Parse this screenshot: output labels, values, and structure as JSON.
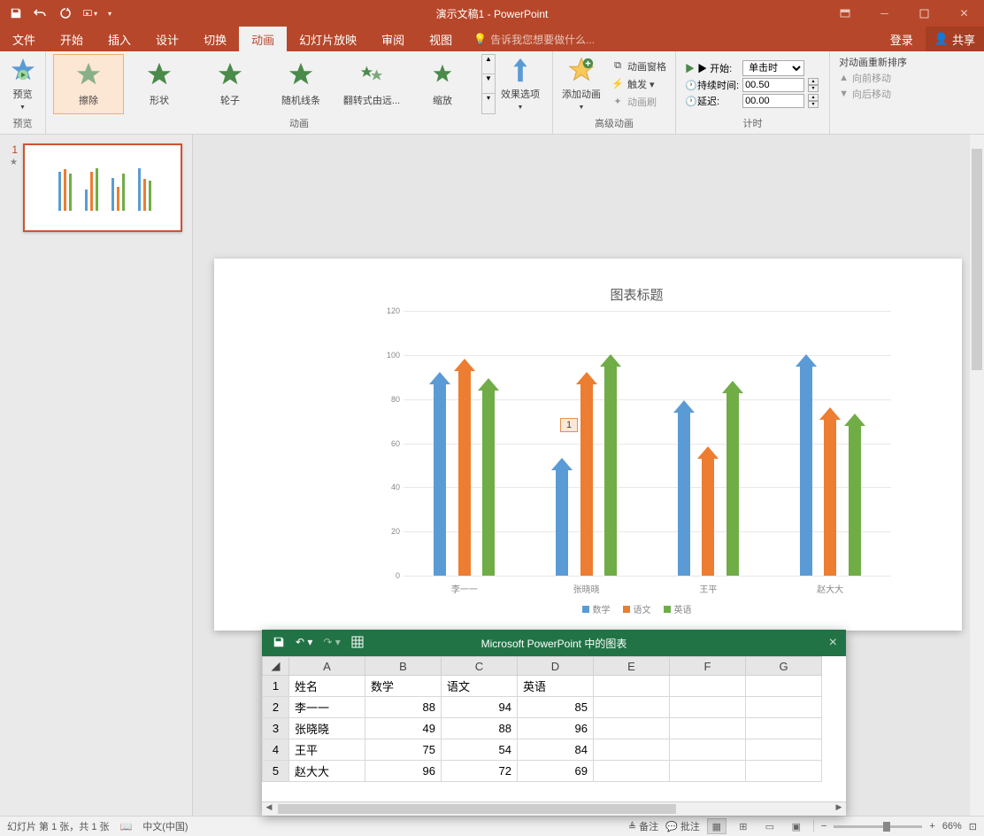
{
  "titlebar": {
    "title": "演示文稿1 - PowerPoint"
  },
  "tabs": {
    "file": "文件",
    "home": "开始",
    "insert": "插入",
    "design": "设计",
    "transitions": "切换",
    "animations": "动画",
    "slideshow": "幻灯片放映",
    "review": "审阅",
    "view": "视图",
    "tellme": "告诉我您想要做什么...",
    "login": "登录",
    "share": "共享"
  },
  "ribbon": {
    "preview": "预览",
    "preview_group": "预览",
    "anim_group": "动画",
    "gallery": {
      "wipe": "擦除",
      "shape": "形状",
      "wheel": "轮子",
      "random_bars": "随机线条",
      "flip": "翻转式由远...",
      "zoom": "缩放"
    },
    "effect_options": "效果选项",
    "advanced_group": "高级动画",
    "add_animation": "添加动画",
    "animation_pane": "动画窗格",
    "trigger": "触发 ▾",
    "painter": "动画刷",
    "timing_group": "计时",
    "start_label": "▶ 开始:",
    "start_value": "单击时",
    "duration_label": "持续时间:",
    "duration_value": "00.50",
    "delay_label": "延迟:",
    "delay_value": "00.00",
    "reorder_title": "对动画重新排序",
    "move_earlier": "向前移动",
    "move_later": "向后移动"
  },
  "slide": {
    "number": "1",
    "anim_tag": "1"
  },
  "chart_data": {
    "type": "bar",
    "title": "图表标题",
    "categories": [
      "李一一",
      "张晓晓",
      "王平",
      "赵大大"
    ],
    "series": [
      {
        "name": "数学",
        "color": "#5b9bd5",
        "values": [
          88,
          49,
          75,
          96
        ]
      },
      {
        "name": "语文",
        "color": "#ed7d31",
        "values": [
          94,
          88,
          54,
          72
        ]
      },
      {
        "name": "英语",
        "color": "#70ad47",
        "values": [
          85,
          96,
          84,
          69
        ]
      }
    ],
    "ylim": [
      0,
      120
    ],
    "yticks": [
      0,
      20,
      40,
      60,
      80,
      100,
      120
    ]
  },
  "excel": {
    "title": "Microsoft PowerPoint 中的图表",
    "cols": [
      "A",
      "B",
      "C",
      "D",
      "E",
      "F",
      "G"
    ],
    "rows": [
      [
        "姓名",
        "数学",
        "语文",
        "英语",
        "",
        "",
        ""
      ],
      [
        "李一一",
        "88",
        "94",
        "85",
        "",
        "",
        ""
      ],
      [
        "张晓晓",
        "49",
        "88",
        "96",
        "",
        "",
        ""
      ],
      [
        "王平",
        "75",
        "54",
        "84",
        "",
        "",
        ""
      ],
      [
        "赵大大",
        "96",
        "72",
        "69",
        "",
        "",
        ""
      ]
    ]
  },
  "status": {
    "slide_info": "幻灯片 第 1 张，共 1 张",
    "language": "中文(中国)",
    "notes": "备注",
    "comments": "批注",
    "zoom": "66%"
  }
}
